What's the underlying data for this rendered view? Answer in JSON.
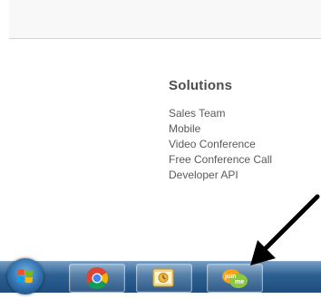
{
  "solutions": {
    "title": "Solutions",
    "items": [
      "Sales Team",
      "Mobile",
      "Video Conference",
      "Free Conference Call",
      "Developer API"
    ]
  },
  "taskbar": {
    "items": [
      {
        "name": "start-button",
        "icon": "windows-logo-icon"
      },
      {
        "name": "chrome",
        "icon": "chrome-icon"
      },
      {
        "name": "outlook",
        "icon": "outlook-icon"
      },
      {
        "name": "joinme",
        "icon": "joinme-icon",
        "icon_text_top": "join",
        "icon_text_bottom": "me"
      }
    ]
  },
  "annotation": {
    "icon": "arrow-icon",
    "color": "#000000"
  },
  "colors": {
    "taskbar": "#2c5f91",
    "joinme_orange": "#f7a11a",
    "joinme_green": "#8dc63f"
  }
}
